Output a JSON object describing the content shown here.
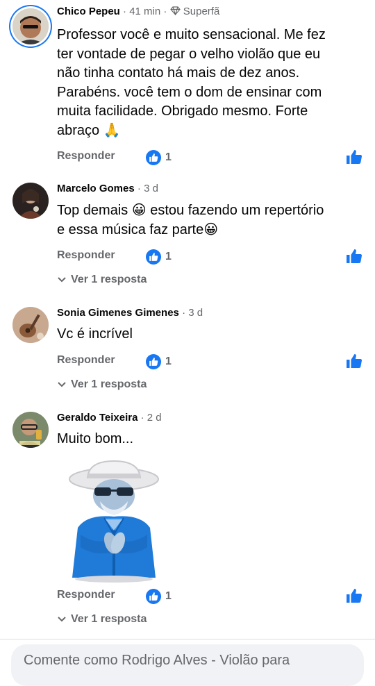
{
  "colors": {
    "accent": "#1877f2",
    "muted": "#65676b",
    "text": "#050505"
  },
  "comments": [
    {
      "author": "Chico Pepeu",
      "dot": "·",
      "time": "41 min",
      "badge": "Superfã",
      "badge_icon": "diamond-icon",
      "lines": [
        "Professor você e muito sensacional.  Me fez",
        "ter vontade de pegar o velho violão que eu",
        "não tinha contato há mais de dez anos.",
        "Parabéns.  você tem o dom de ensinar com",
        "muita facilidade.  Obrigado mesmo.  Forte",
        "abraço 🙏"
      ],
      "reply_label": "Responder",
      "reaction_count": "1"
    },
    {
      "author": "Marcelo Gomes",
      "dot": "·",
      "time": "3 d",
      "lines": [
        "Top demais 😀 estou fazendo um repertório",
        "e essa música faz parte😀"
      ],
      "reply_label": "Responder",
      "reaction_count": "1",
      "view_replies": "Ver 1 resposta"
    },
    {
      "author": "Sonia Gimenes Gimenes",
      "dot": "·",
      "time": "3 d",
      "lines": [
        "Vc é incrível"
      ],
      "reply_label": "Responder",
      "reaction_count": "1",
      "view_replies": "Ver 1 resposta"
    },
    {
      "author": "Geraldo Teixeira",
      "dot": "·",
      "time": "2 d",
      "lines": [
        "Muito bom..."
      ],
      "sticker": "clapping-man-in-hat-sticker",
      "reply_label": "Responder",
      "reaction_count": "1",
      "view_replies": "Ver 1 resposta"
    }
  ],
  "composer": {
    "placeholder": "Comente como Rodrigo Alves - Violão para"
  }
}
